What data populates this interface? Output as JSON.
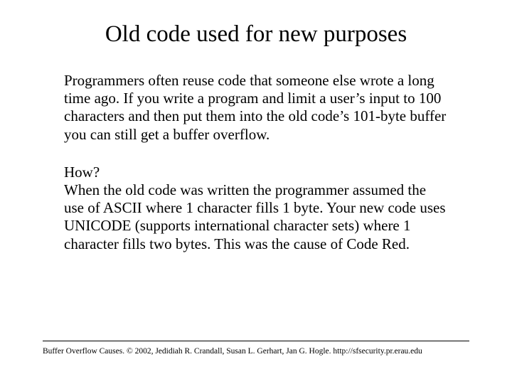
{
  "slide": {
    "title": "Old code used for new purposes",
    "paragraph1": "Programmers often reuse code that someone else wrote a long time ago.  If you write a program and limit a user’s input to 100 characters and then put them into the old code’s 101-byte buffer you can still get a buffer overflow.",
    "question": "How?",
    "paragraph2": "When the old code was written the programmer assumed the use of ASCII where 1 character fills 1 byte.  Your new code uses UNICODE (supports international character sets) where 1 character fills two bytes.  This was the cause of Code Red.",
    "footer": "Buffer Overflow Causes. © 2002, Jedidiah R. Crandall, Susan L. Gerhart, Jan G. Hogle.  http://sfsecurity.pr.erau.edu"
  }
}
